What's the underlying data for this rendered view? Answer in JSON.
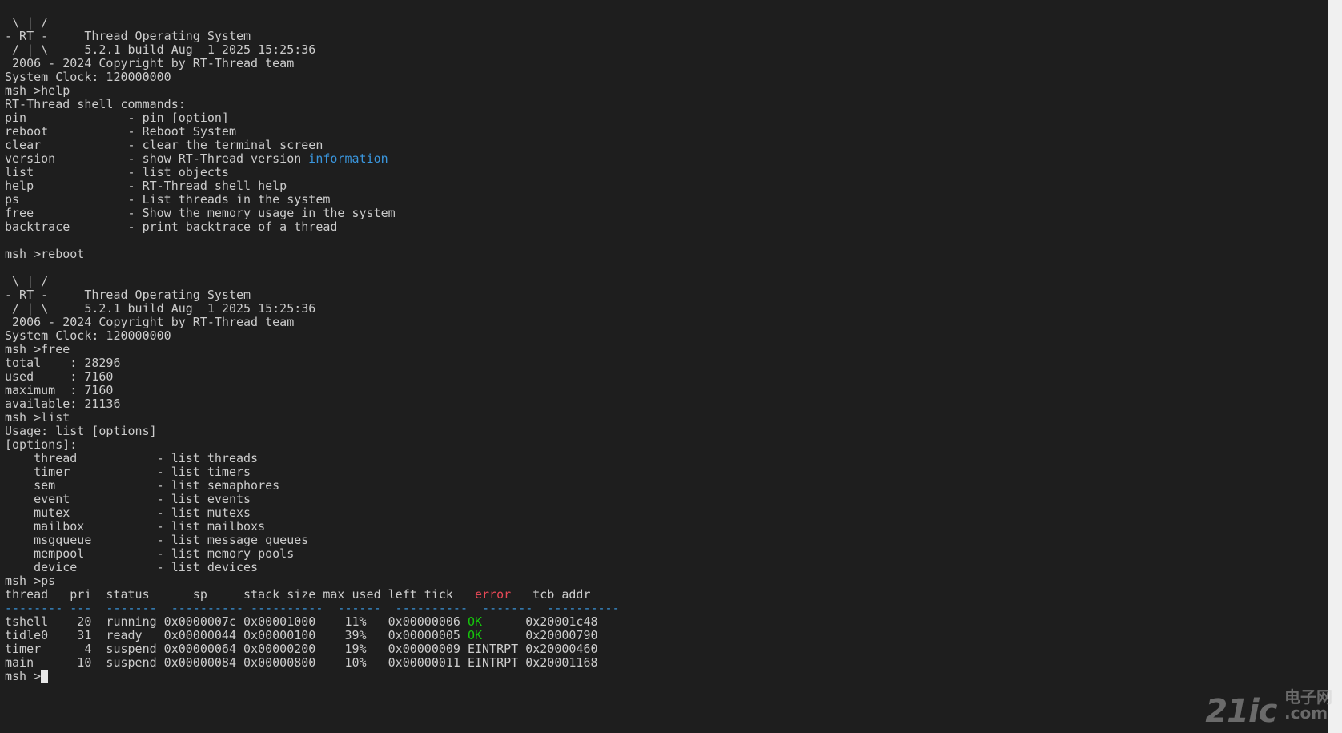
{
  "colors": {
    "background": "#1e1e1e",
    "foreground": "#cccccc",
    "blue": "#3a96dd",
    "red": "#e74856",
    "green": "#16c60c"
  },
  "terminal": {
    "lines": [
      [
        {
          "t": " \\ | /"
        }
      ],
      [
        {
          "t": "- RT -     Thread Operating System"
        }
      ],
      [
        {
          "t": " / | \\     5.2.1 build Aug  1 2025 15:25:36"
        }
      ],
      [
        {
          "t": " 2006 - 2024 Copyright by RT-Thread team"
        }
      ],
      [
        {
          "t": "System Clock: 120000000"
        }
      ],
      [
        {
          "t": "msh >help"
        }
      ],
      [
        {
          "t": "RT-Thread shell commands:"
        }
      ],
      [
        {
          "t": "pin              - pin [option]"
        }
      ],
      [
        {
          "t": "reboot           - Reboot System"
        }
      ],
      [
        {
          "t": "clear            - clear the terminal screen"
        }
      ],
      [
        {
          "t": "version          - show RT-Thread version "
        },
        {
          "t": "information",
          "c": "blue"
        }
      ],
      [
        {
          "t": "list             - list objects"
        }
      ],
      [
        {
          "t": "help             - RT-Thread shell help"
        }
      ],
      [
        {
          "t": "ps               - List threads in the system"
        }
      ],
      [
        {
          "t": "free             - Show the memory usage in the system"
        }
      ],
      [
        {
          "t": "backtrace        - print backtrace of a thread"
        }
      ],
      [
        {
          "t": ""
        }
      ],
      [
        {
          "t": "msh >reboot"
        }
      ],
      [
        {
          "t": ""
        }
      ],
      [
        {
          "t": " \\ | /"
        }
      ],
      [
        {
          "t": "- RT -     Thread Operating System"
        }
      ],
      [
        {
          "t": " / | \\     5.2.1 build Aug  1 2025 15:25:36"
        }
      ],
      [
        {
          "t": " 2006 - 2024 Copyright by RT-Thread team"
        }
      ],
      [
        {
          "t": "System Clock: 120000000"
        }
      ],
      [
        {
          "t": "msh >free"
        }
      ],
      [
        {
          "t": "total    : 28296"
        }
      ],
      [
        {
          "t": "used     : 7160"
        }
      ],
      [
        {
          "t": "maximum  : 7160"
        }
      ],
      [
        {
          "t": "available: 21136"
        }
      ],
      [
        {
          "t": "msh >list"
        }
      ],
      [
        {
          "t": "Usage: list [options]"
        }
      ],
      [
        {
          "t": "[options]:"
        }
      ],
      [
        {
          "t": "    thread           - list threads"
        }
      ],
      [
        {
          "t": "    timer            - list timers"
        }
      ],
      [
        {
          "t": "    sem              - list semaphores"
        }
      ],
      [
        {
          "t": "    event            - list events"
        }
      ],
      [
        {
          "t": "    mutex            - list mutexs"
        }
      ],
      [
        {
          "t": "    mailbox          - list mailboxs"
        }
      ],
      [
        {
          "t": "    msgqueue         - list message queues"
        }
      ],
      [
        {
          "t": "    mempool          - list memory pools"
        }
      ],
      [
        {
          "t": "    device           - list devices"
        }
      ],
      [
        {
          "t": "msh >ps"
        }
      ],
      [
        {
          "t": "thread   pri  status      sp     stack size max used left tick   "
        },
        {
          "t": "error",
          "c": "red"
        },
        {
          "t": "   tcb addr"
        }
      ],
      [
        {
          "t": "-------- ",
          "c": "blue"
        },
        {
          "t": "---",
          "c": "blue"
        },
        {
          "t": "  -------  ---------- ----------  ------  ----------  -------  ----------",
          "c": "blue"
        }
      ],
      [
        {
          "t": "tshell    20  running 0x0000007c 0x00001000    11%   0x00000006 "
        },
        {
          "t": "OK",
          "c": "green"
        },
        {
          "t": "      0x20001c48"
        }
      ],
      [
        {
          "t": "tidle0    31  ready   0x00000044 0x00000100    39%   0x00000005 "
        },
        {
          "t": "OK",
          "c": "green"
        },
        {
          "t": "      0x20000790"
        }
      ],
      [
        {
          "t": "timer      4  suspend 0x00000064 0x00000200    19%   0x00000009 EINTRPT 0x20000460"
        }
      ],
      [
        {
          "t": "main      10  suspend 0x00000084 0x00000800    10%   0x00000011 EINTRPT 0x20001168"
        }
      ],
      [
        {
          "t": "msh >"
        },
        {
          "cursor": true
        }
      ]
    ]
  },
  "watermark": {
    "big": "21ic",
    "top": "电子网",
    "bottom": ".com"
  }
}
